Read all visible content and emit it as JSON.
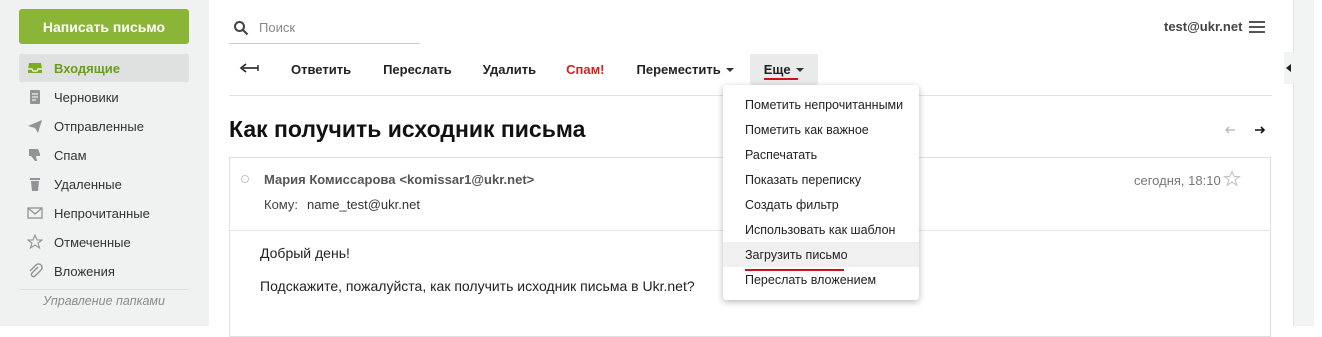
{
  "sidebar": {
    "compose_label": "Написать письмо",
    "folders": [
      {
        "label": "Входящие",
        "icon": "inbox-icon",
        "active": true
      },
      {
        "label": "Черновики",
        "icon": "drafts-icon"
      },
      {
        "label": "Отправленные",
        "icon": "sent-icon"
      },
      {
        "label": "Спам",
        "icon": "spam-icon"
      },
      {
        "label": "Удаленные",
        "icon": "trash-icon"
      },
      {
        "label": "Непрочитанные",
        "icon": "envelope-icon"
      },
      {
        "label": "Отмеченные",
        "icon": "star-icon"
      },
      {
        "label": "Вложения",
        "icon": "paperclip-icon"
      }
    ],
    "manage_folders_label": "Управление папками"
  },
  "header": {
    "search_placeholder": "Поиск",
    "account": "test@ukr.net"
  },
  "toolbar": {
    "reply_label": "Ответить",
    "forward_label": "Переслать",
    "delete_label": "Удалить",
    "spam_label": "Спам!",
    "move_label": "Переместить",
    "more_label": "Еще"
  },
  "message": {
    "subject": "Как получить исходник письма",
    "sender_name": "Мария Комиссарова",
    "sender_email": "<komissar1@ukr.net>",
    "to_label": "Кому:",
    "to_address": "name_test@ukr.net",
    "date": "сегодня, 18:10",
    "body": [
      "Добрый день!",
      "Подскажите, пожалуйста, как получить исходник письма в Ukr.net?"
    ]
  },
  "more_menu": {
    "items": [
      "Пометить непрочитанными",
      "Пометить как важное",
      "Распечатать",
      "Показать переписку",
      "Создать фильтр",
      "Использовать как шаблон",
      "Загрузить письмо",
      "Переслать вложением"
    ],
    "highlighted_index": 6
  },
  "colors": {
    "compose": "#8bb536",
    "active_folder_text": "#6b9c1c",
    "spam_text": "#d31f1f",
    "underline_accent": "#d0101b"
  }
}
